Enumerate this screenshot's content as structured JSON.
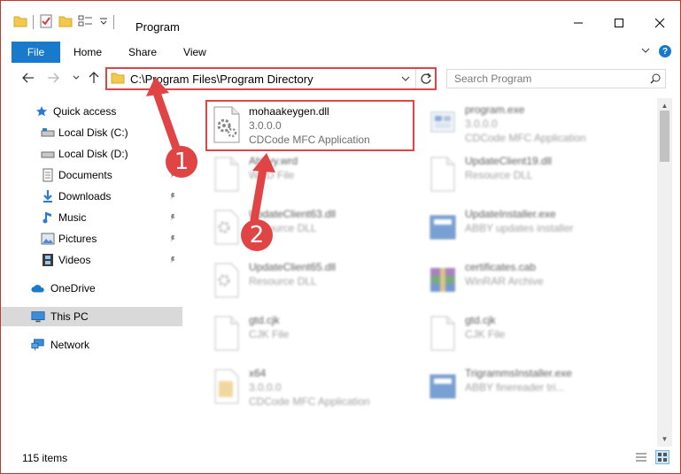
{
  "window": {
    "title": "Program",
    "controls": {
      "minimize": "minimize-icon",
      "maximize": "maximize-icon",
      "close": "close-icon"
    }
  },
  "ribbon": {
    "tabs": [
      "File",
      "Home",
      "Share",
      "View"
    ]
  },
  "address": {
    "path": "C:\\Program Files\\Program Directory"
  },
  "search": {
    "placeholder": "Search Program"
  },
  "sidebar": {
    "items": [
      {
        "label": "Quick access",
        "icon": "star-icon"
      },
      {
        "label": "Local Disk (C:)",
        "icon": "drive-icon"
      },
      {
        "label": "Local Disk (D:)",
        "icon": "drive-icon"
      },
      {
        "label": "Documents",
        "icon": "documents-icon",
        "pinned": true
      },
      {
        "label": "Downloads",
        "icon": "download-icon",
        "pinned": true
      },
      {
        "label": "Music",
        "icon": "music-icon",
        "pinned": true
      },
      {
        "label": "Pictures",
        "icon": "pictures-icon",
        "pinned": true
      },
      {
        "label": "Videos",
        "icon": "videos-icon",
        "pinned": true
      },
      {
        "label": "OneDrive",
        "icon": "cloud-icon"
      },
      {
        "label": "This PC",
        "icon": "computer-icon",
        "selected": true
      },
      {
        "label": "Network",
        "icon": "network-icon"
      }
    ]
  },
  "files": [
    {
      "name": "mohaakeygen.dll",
      "line2": "3.0.0.0",
      "line3": "CDCode MFC Application",
      "icon": "dll-gear-icon",
      "highlighted": true
    },
    {
      "name": "program.exe",
      "line2": "3.0.0.0",
      "line3": "CDCode MFC Application",
      "icon": "exe-icon"
    },
    {
      "name": "Abbyy.wrd",
      "line2": "WRD File",
      "line3": "",
      "icon": "blank-file-icon"
    },
    {
      "name": "UpdateClient19.dll",
      "line2": "Resource DLL",
      "line3": "",
      "icon": "blank-file-icon"
    },
    {
      "name": "UpdateClient63.dll",
      "line2": "Resource DLL",
      "line3": "",
      "icon": "dll-gear-icon"
    },
    {
      "name": "UpdateInstaller.exe",
      "line2": "ABBY updates installer",
      "line3": "",
      "icon": "installer-icon"
    },
    {
      "name": "UpdateClient65.dll",
      "line2": "Resource DLL",
      "line3": "",
      "icon": "dll-gear-icon"
    },
    {
      "name": "certificates.cab",
      "line2": "WinRAR Archive",
      "line3": "",
      "icon": "winrar-icon"
    },
    {
      "name": "gtd.cjk",
      "line2": "CJK File",
      "line3": "",
      "icon": "blank-file-icon"
    },
    {
      "name": "gtd.cjk",
      "line2": "CJK File",
      "line3": "",
      "icon": "blank-file-icon"
    },
    {
      "name": "x64",
      "line2": "3.0.0.0",
      "line3": "CDCode MFC Application",
      "icon": "folder-icon"
    },
    {
      "name": "TrigrammsInstaller.exe",
      "line2": "ABBY finereader tri...",
      "line3": "",
      "icon": "installer-icon"
    }
  ],
  "status": {
    "count": "115 items"
  },
  "annotations": {
    "callout1": "1",
    "callout2": "2"
  },
  "colors": {
    "accent": "#1979ca",
    "highlight_red": "#e04444",
    "selected_bg": "#cce8ff"
  }
}
